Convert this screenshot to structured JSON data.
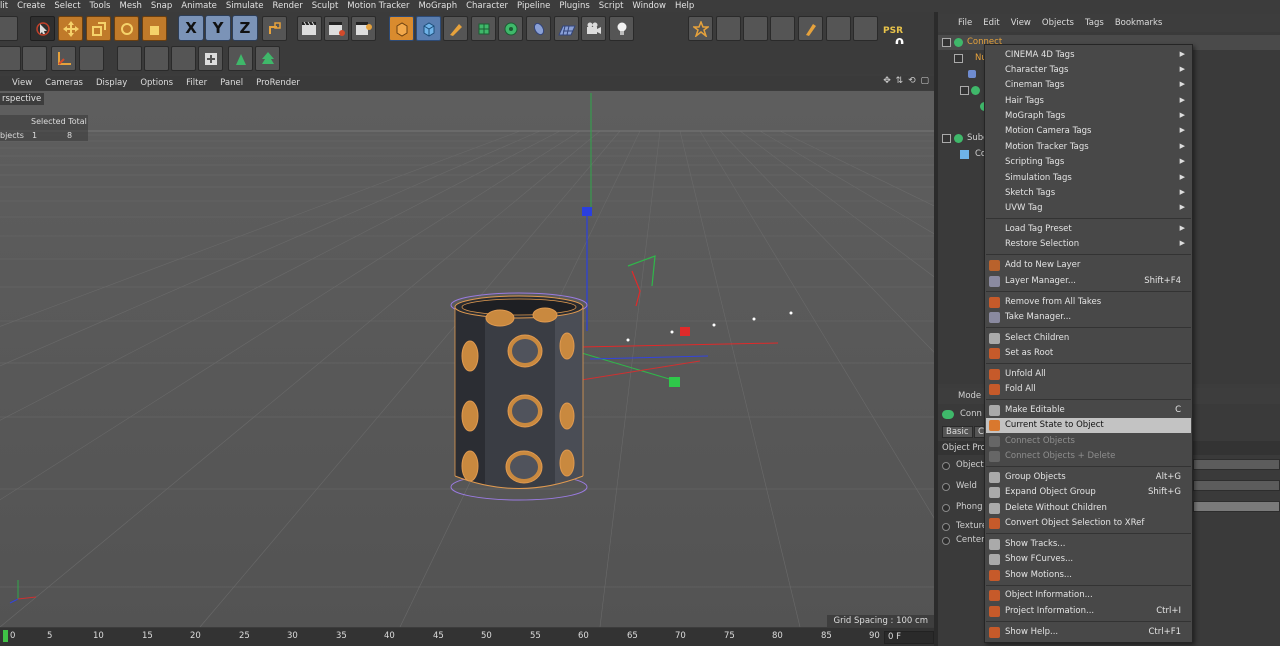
{
  "main_menu": [
    "lit",
    "Create",
    "Select",
    "Tools",
    "Mesh",
    "Snap",
    "Animate",
    "Simulate",
    "Render",
    "Sculpt",
    "Motion Tracker",
    "MoGraph",
    "Character",
    "Pipeline",
    "Plugins",
    "Script",
    "Window",
    "Help"
  ],
  "toolbar": {
    "axis_x": "X",
    "axis_y": "Y",
    "axis_z": "Z",
    "psr_label": "PSR",
    "psr_value": "0"
  },
  "viewport_menu": [
    "View",
    "Cameras",
    "Display",
    "Options",
    "Filter",
    "Panel",
    "ProRender"
  ],
  "viewport": {
    "title": "rspective",
    "stats_header": "Selected Total",
    "stats_label": "bjects",
    "stats_selected": "1",
    "stats_total": "8",
    "grid_spacing": "Grid Spacing : 100 cm"
  },
  "timeline": {
    "ticks": [
      "0",
      "5",
      "10",
      "15",
      "20",
      "25",
      "30",
      "35",
      "40",
      "45",
      "50",
      "55",
      "60",
      "65",
      "70",
      "75",
      "80",
      "85",
      "90"
    ],
    "frame_field": "0 F"
  },
  "object_manager": {
    "menu": [
      "File",
      "Edit",
      "View",
      "Objects",
      "Tags",
      "Bookmarks"
    ],
    "rows": [
      {
        "name": "Connect",
        "highlight": true
      },
      {
        "name": "Nu",
        "highlight": false
      },
      {
        "name": "",
        "highlight": false
      },
      {
        "name": "",
        "highlight": false
      },
      {
        "name": "",
        "highlight": false
      },
      {
        "name": "",
        "highlight": false
      },
      {
        "name": "Subd",
        "highlight": false
      },
      {
        "name": "Co",
        "highlight": false
      }
    ]
  },
  "attribute_manager": {
    "title": "Mode",
    "object_name": "Conn",
    "tab_basic": "Basic",
    "tab_c": "C",
    "section": "Object Pro",
    "rows": [
      "Objects",
      "Weld",
      "Phong",
      "Texture",
      "Center"
    ]
  },
  "context_menu": {
    "items": [
      {
        "label": "CINEMA 4D Tags",
        "submenu": true
      },
      {
        "label": "Character Tags",
        "submenu": true
      },
      {
        "label": "Cineman Tags",
        "submenu": true
      },
      {
        "label": "Hair Tags",
        "submenu": true
      },
      {
        "label": "MoGraph Tags",
        "submenu": true
      },
      {
        "label": "Motion Camera Tags",
        "submenu": true
      },
      {
        "label": "Motion Tracker Tags",
        "submenu": true
      },
      {
        "label": "Scripting Tags",
        "submenu": true
      },
      {
        "label": "Simulation Tags",
        "submenu": true
      },
      {
        "label": "Sketch Tags",
        "submenu": true
      },
      {
        "label": "UVW Tag",
        "submenu": true
      },
      {
        "label": "Load Tag Preset",
        "submenu": true
      },
      {
        "label": "Restore Selection",
        "submenu": true
      },
      {
        "label": "Add to New Layer",
        "icon": "layer-add-icon"
      },
      {
        "label": "Layer Manager...",
        "shortcut": "Shift+F4",
        "icon": "layer-manager-icon"
      },
      {
        "label": "Remove from All Takes",
        "icon": "take-remove-icon"
      },
      {
        "label": "Take Manager...",
        "icon": "take-manager-icon"
      },
      {
        "label": "Select Children",
        "icon": "select-children-icon"
      },
      {
        "label": "Set as Root",
        "icon": "set-root-icon"
      },
      {
        "label": "Unfold All",
        "icon": "unfold-icon"
      },
      {
        "label": "Fold All",
        "icon": "fold-icon"
      },
      {
        "label": "Make Editable",
        "shortcut": "C",
        "icon": "make-editable-icon"
      },
      {
        "label": "Current State to Object",
        "icon": "current-state-icon",
        "highlighted": true
      },
      {
        "label": "Connect Objects",
        "icon": "connect-icon",
        "disabled": true
      },
      {
        "label": "Connect Objects + Delete",
        "icon": "connect-delete-icon",
        "disabled": true
      },
      {
        "label": "Group Objects",
        "shortcut": "Alt+G",
        "icon": "group-icon"
      },
      {
        "label": "Expand Object Group",
        "shortcut": "Shift+G",
        "icon": "expand-group-icon"
      },
      {
        "label": "Delete Without Children",
        "icon": "delete-icon"
      },
      {
        "label": "Convert Object Selection to XRef",
        "icon": "xref-icon"
      },
      {
        "label": "Show Tracks...",
        "icon": "tracks-icon"
      },
      {
        "label": "Show FCurves...",
        "icon": "fcurves-icon"
      },
      {
        "label": "Show Motions...",
        "icon": "motions-icon"
      },
      {
        "label": "Object Information...",
        "icon": "info-icon"
      },
      {
        "label": "Project Information...",
        "shortcut": "Ctrl+I",
        "icon": "project-info-icon"
      },
      {
        "label": "Show Help...",
        "shortcut": "Ctrl+F1",
        "icon": "help-icon"
      }
    ]
  },
  "colors": {
    "accent_orange": "#c07a2a",
    "menu_highlight": "#c3c3c3",
    "axis_x": "#e02020",
    "axis_y": "#20c020",
    "axis_z": "#2040e0"
  }
}
